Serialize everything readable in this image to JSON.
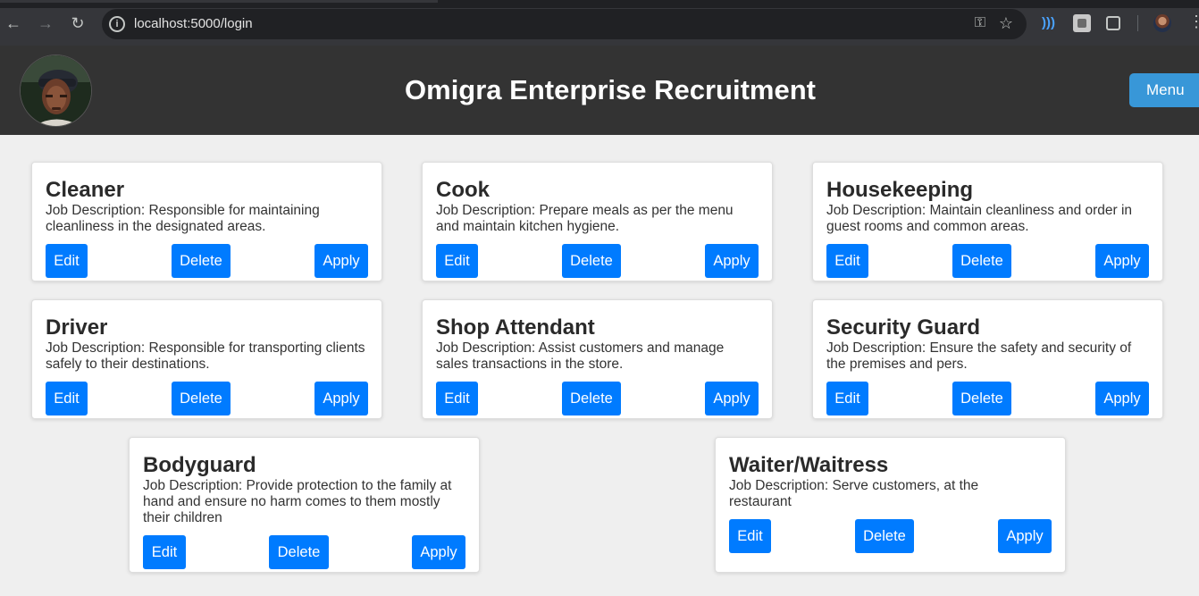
{
  "browser": {
    "url": "localhost:5000/login"
  },
  "header": {
    "title": "Omigra Enterprise Recruitment",
    "menu_label": "Menu"
  },
  "jobs": [
    {
      "title": "Cleaner",
      "description": "Job Description: Responsible for maintaining cleanliness in the designated areas."
    },
    {
      "title": "Cook",
      "description": "Job Description: Prepare meals as per the menu and maintain kitchen hygiene."
    },
    {
      "title": "Housekeeping",
      "description": "Job Description: Maintain cleanliness and order in guest rooms and common areas."
    },
    {
      "title": "Driver",
      "description": "Job Description: Responsible for transporting clients safely to their destinations."
    },
    {
      "title": "Shop Attendant",
      "description": "Job Description: Assist customers and manage sales transactions in the store."
    },
    {
      "title": "Security Guard",
      "description": "Job Description: Ensure the safety and security of the premises and pers."
    },
    {
      "title": "Bodyguard",
      "description": "Job Description: Provide protection to the family at hand and ensure no harm comes to them mostly their children"
    },
    {
      "title": "Waiter/Waitress",
      "description": "Job Description: Serve customers, at the restaurant"
    }
  ],
  "actions": {
    "edit_label": "Edit",
    "delete_label": "Delete",
    "apply_label": "Apply"
  },
  "colors": {
    "header_bg": "#333333",
    "page_bg": "#efefef",
    "action_button": "#007bff",
    "menu_button": "#3897d8"
  }
}
